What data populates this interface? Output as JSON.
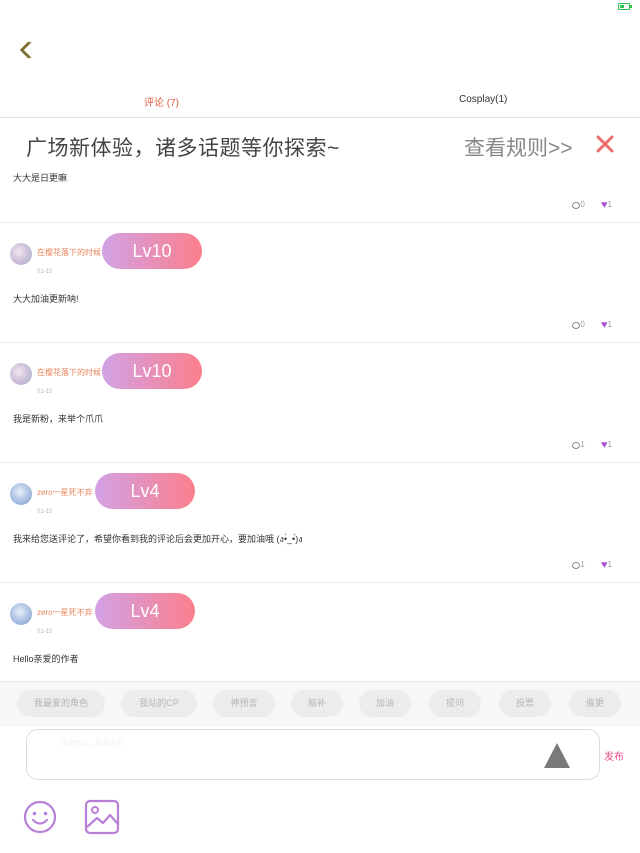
{
  "tabs": [
    {
      "label": "评论 (7)",
      "active": true
    },
    {
      "label": "Cosplay(1)",
      "active": false
    }
  ],
  "banner": {
    "text": "广场新体验，诸多话题等你探索~",
    "rules_link": "查看规则>>"
  },
  "posts": [
    {
      "username": "",
      "level": "",
      "date": "",
      "content": "大大是日更嘛",
      "comments": "0",
      "likes": "1"
    },
    {
      "username": "在樱花落下的时候",
      "level": "Lv10",
      "date": "01-15",
      "content": "大大加油更新呐!",
      "comments": "0",
      "likes": "1"
    },
    {
      "username": "在樱花落下的时候",
      "level": "Lv10",
      "date": "01-15",
      "content": "我是新粉，来举个爪爪",
      "comments": "1",
      "likes": "1"
    },
    {
      "username": "zero一星死不弃",
      "level": "Lv4",
      "date": "01-15",
      "content": "我来给您送评论了，希望你看到我的评论后会更加开心，要加油哦 (ง•̀_•́)ง",
      "comments": "1",
      "likes": "1"
    },
    {
      "username": "zero一星死不弃",
      "level": "Lv4",
      "date": "01-15",
      "content": "Hello亲爱的作者",
      "comments": "",
      "likes": ""
    }
  ],
  "tags": [
    "我最爱的角色",
    "我站的CP",
    "神预言",
    "脑补",
    "加油",
    "提问",
    "投票",
    "催更"
  ],
  "input": {
    "placeholder": "说点什么...发表评论"
  },
  "publish_label": "发布",
  "colors": {
    "accent": "#e35a3f",
    "level_start": "#d2a2e6",
    "level_end": "#fb7f8c",
    "publish": "#e9508b",
    "like": "#a85ad1",
    "username": "#e8855b"
  }
}
